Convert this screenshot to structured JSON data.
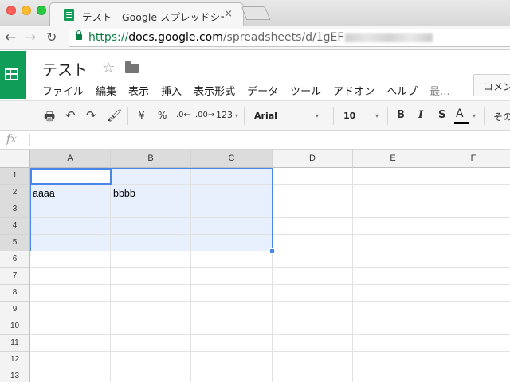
{
  "browser": {
    "tab_title": "テスト - Google スプレッドシー",
    "tab_close": "×",
    "url_scheme": "https://",
    "url_host": "docs.google.com",
    "url_path": "/spreadsheets/d/1gEF"
  },
  "doc": {
    "title": "テスト",
    "star": "☆"
  },
  "menu": [
    "ファイル",
    "編集",
    "表示",
    "挿入",
    "表示形式",
    "データ",
    "ツール",
    "アドオン",
    "ヘルプ",
    "最..."
  ],
  "comment_button": "コメン",
  "toolbar": {
    "print": "🖶",
    "undo": "↶",
    "redo": "↷",
    "paint": "🖌",
    "currency": "¥",
    "percent": "%",
    "dec_decrease": ".0←",
    "dec_increase": ".00→",
    "number_format": "123",
    "font": "Arial",
    "size": "10",
    "bold": "B",
    "italic": "I",
    "strike": "S",
    "text_color": "A",
    "more": "その",
    "caret": "▾"
  },
  "formula_bar": {
    "label": "fx",
    "value": ""
  },
  "grid": {
    "columns": [
      "A",
      "B",
      "C",
      "D",
      "E",
      "F"
    ],
    "rows": [
      "1",
      "2",
      "3",
      "4",
      "5",
      "6",
      "7",
      "8",
      "9",
      "10",
      "11",
      "12",
      "13"
    ],
    "cells": {
      "A2": "aaaa",
      "B2": "bbbb"
    }
  },
  "colors": {
    "selection": "#4a86e8",
    "selection_fill": "#e8f0fe",
    "brand": "#0f9d58"
  }
}
